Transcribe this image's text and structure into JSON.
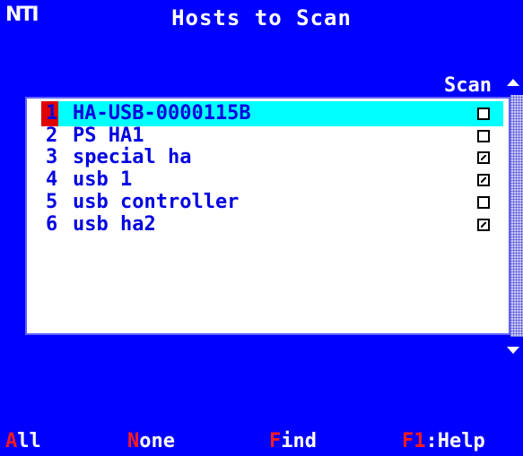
{
  "header": {
    "logo_text": "NTI",
    "title": "Hosts to Scan"
  },
  "list": {
    "column_header": "Scan",
    "rows": [
      {
        "num": "1",
        "name": "HA-USB-0000115B",
        "scan": false,
        "selected": true
      },
      {
        "num": "2",
        "name": "PS HA1",
        "scan": false,
        "selected": false
      },
      {
        "num": "3",
        "name": "special ha",
        "scan": true,
        "selected": false
      },
      {
        "num": "4",
        "name": "usb 1",
        "scan": true,
        "selected": false
      },
      {
        "num": "5",
        "name": "usb controller",
        "scan": false,
        "selected": false
      },
      {
        "num": "6",
        "name": "usb ha2",
        "scan": true,
        "selected": false
      }
    ]
  },
  "footer": {
    "all": {
      "hotkey": "A",
      "rest": "ll"
    },
    "none": {
      "hotkey": "N",
      "rest": "one"
    },
    "find": {
      "hotkey": "F",
      "rest": "ind"
    },
    "help": {
      "hotkey": "F1",
      "rest": ":Help"
    }
  },
  "colors": {
    "background": "#0000ff",
    "selection": "#00ffff",
    "hotkey": "#ff1a1a",
    "cursor": "#e00000",
    "list_text": "#0000e0"
  }
}
